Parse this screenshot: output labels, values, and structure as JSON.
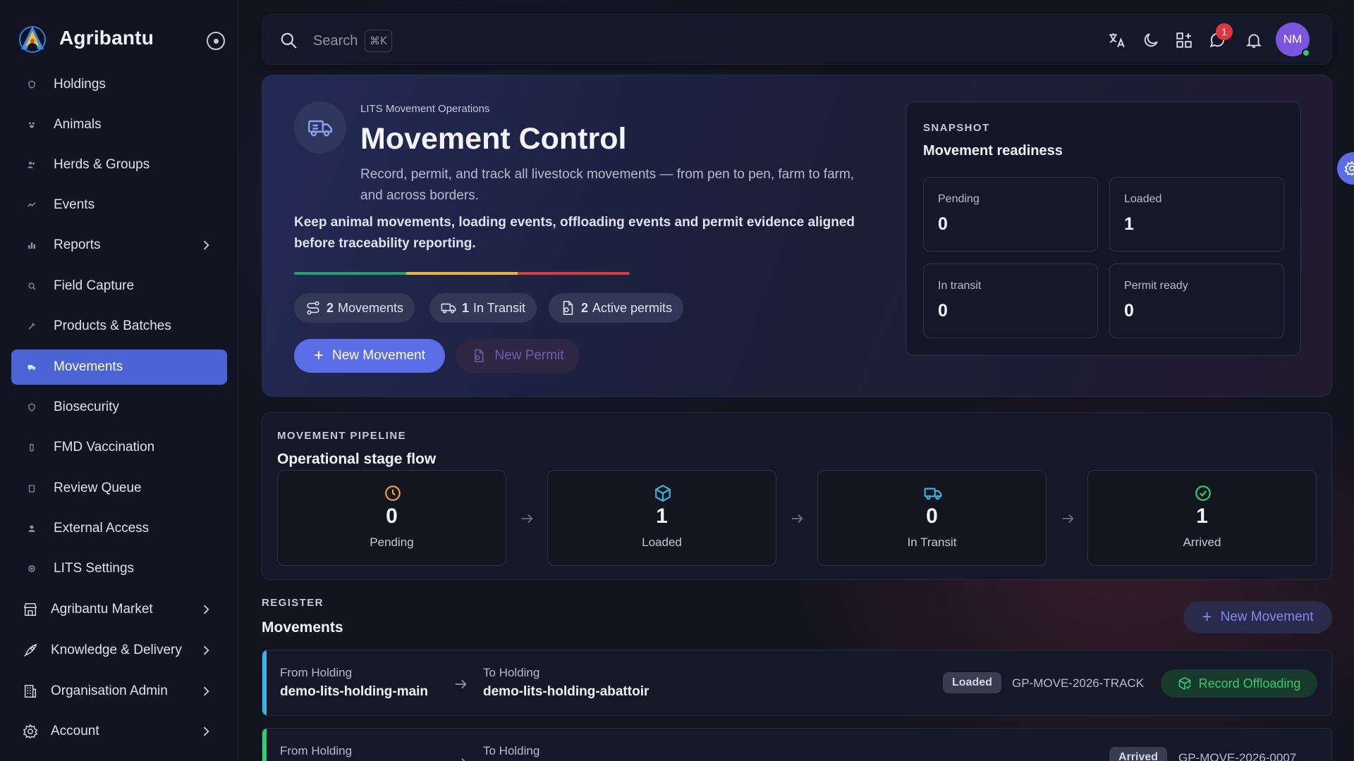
{
  "brand": {
    "name": "Agribantu"
  },
  "sidebar": {
    "items": [
      {
        "label": "Holdings",
        "icon": "shield-icon"
      },
      {
        "label": "Animals",
        "icon": "paw-icon"
      },
      {
        "label": "Herds & Groups",
        "icon": "users-icon"
      },
      {
        "label": "Events",
        "icon": "activity-icon"
      },
      {
        "label": "Reports",
        "icon": "bar-chart-icon"
      },
      {
        "label": "Field Capture",
        "icon": "map-pin-icon"
      },
      {
        "label": "Products & Batches",
        "icon": "syringe-icon"
      },
      {
        "label": "Movements",
        "icon": "truck-icon"
      },
      {
        "label": "Biosecurity",
        "icon": "shield-check-icon"
      },
      {
        "label": "FMD Vaccination",
        "icon": "vial-icon"
      },
      {
        "label": "Review Queue",
        "icon": "clipboard-icon"
      },
      {
        "label": "External Access",
        "icon": "user-icon"
      },
      {
        "label": "LITS Settings",
        "icon": "settings-icon"
      },
      {
        "label": "Agribantu Market",
        "icon": "store-icon"
      },
      {
        "label": "Knowledge & Delivery",
        "icon": "rocket-icon"
      },
      {
        "label": "Organisation Admin",
        "icon": "building-icon"
      },
      {
        "label": "Account",
        "icon": "gear-icon"
      }
    ]
  },
  "topbar": {
    "search_placeholder": "Search",
    "shortcut": "⌘K",
    "notification_count": "1",
    "avatar_initials": "NM"
  },
  "hero": {
    "eyebrow": "LITS Movement Operations",
    "title": "Movement Control",
    "description": "Record, permit, and track all livestock movements — from pen to pen, farm to farm, and across borders.",
    "emphasis": "Keep animal movements, loading events, offloading events and permit evidence aligned before traceability reporting.",
    "stripe_colors": [
      "#1aa36a",
      "#e8b53a",
      "#d93c3c"
    ],
    "pills": [
      {
        "count": "2",
        "label": "Movements"
      },
      {
        "count": "1",
        "label": "In Transit"
      },
      {
        "count": "2",
        "label": "Active permits"
      }
    ],
    "new_movement_label": "New Movement",
    "new_permit_label": "New Permit"
  },
  "snapshot": {
    "eyebrow": "SNAPSHOT",
    "title": "Movement readiness",
    "cards": [
      {
        "label": "Pending",
        "value": "0"
      },
      {
        "label": "Loaded",
        "value": "1"
      },
      {
        "label": "In transit",
        "value": "0"
      },
      {
        "label": "Permit ready",
        "value": "0"
      }
    ]
  },
  "pipeline": {
    "eyebrow": "MOVEMENT PIPELINE",
    "title": "Operational stage flow",
    "stages": [
      {
        "value": "0",
        "label": "Pending",
        "icon": "clock-icon",
        "color": "#f0a13a"
      },
      {
        "value": "1",
        "label": "Loaded",
        "icon": "box-icon",
        "color": "#3bb4e0"
      },
      {
        "value": "0",
        "label": "In Transit",
        "icon": "truck-icon",
        "color": "#3bb4e0"
      },
      {
        "value": "1",
        "label": "Arrived",
        "icon": "check-circle-icon",
        "color": "#2fce6e"
      }
    ]
  },
  "register": {
    "eyebrow": "REGISTER",
    "title": "Movements",
    "new_movement_label": "New Movement",
    "rows": [
      {
        "from_label": "From Holding",
        "from": "demo-lits-holding-main",
        "to_label": "To Holding",
        "to": "demo-lits-holding-abattoir",
        "status": "Loaded",
        "permit": "GP-MOVE-2026-TRACK",
        "action": "Record Offloading",
        "accent": "#3bb4e0"
      },
      {
        "from_label": "From Holding",
        "from": "",
        "to_label": "To Holding",
        "to": "",
        "status": "Arrived",
        "permit": "GP-MOVE-2026-0007",
        "action": "",
        "accent": "#2fce6e"
      }
    ]
  }
}
